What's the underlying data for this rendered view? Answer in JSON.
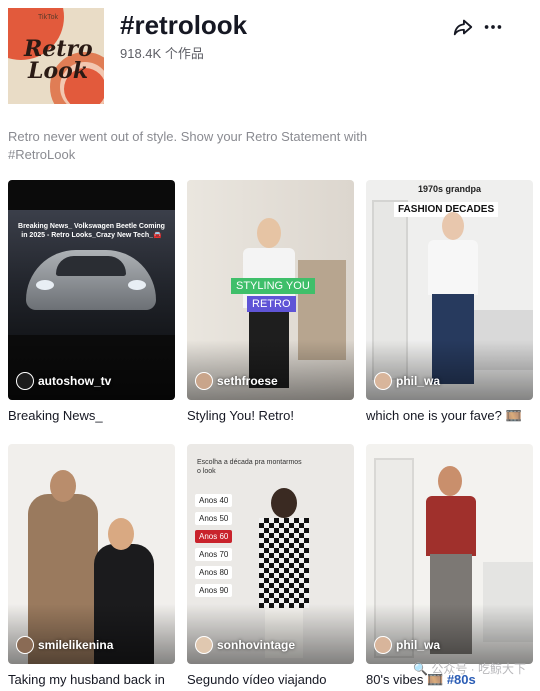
{
  "header": {
    "title": "#retrolook",
    "count": "918.4K 个作品",
    "cover": {
      "brand": "TikTok",
      "word1": "Retro",
      "word2": "Look"
    }
  },
  "description": "Retro never went out of style. Show your Retro Statement with #RetroLook",
  "videos": [
    {
      "author": "autoshow_tv",
      "caption": "Breaking News_",
      "overlay": "Breaking News_ Volkswagen Beetle Coming in 2025 - Retro Looks_Crazy New Tech_🚘"
    },
    {
      "author": "sethfroese",
      "caption": "Styling You! Retro!",
      "tags": [
        "STYLING YOU",
        "RETRO"
      ]
    },
    {
      "author": "phil_wa",
      "caption": "which one is your fave? 🎞️",
      "overlay_top": "1970s grandpa",
      "overlay_label": "FASHION DECADES"
    },
    {
      "author": "smilelikenina",
      "caption": "Taking my husband back in"
    },
    {
      "author": "sonhovintage",
      "caption": "Segundo vídeo viajando",
      "overlay": "Escolha a década pra montarmos o look",
      "decades": [
        "Anos 40",
        "Anos 50",
        "Anos 60",
        "Anos 70",
        "Anos 80",
        "Anos 90"
      ],
      "active_decade": "Anos 60"
    },
    {
      "author": "phil_wa",
      "caption": "80's vibes 🎞️",
      "caption_tag": "#80s"
    }
  ],
  "watermark": "🔍 公众号 · 吃鲸大下",
  "icons": {
    "share": "share-icon",
    "more": "more-icon"
  }
}
